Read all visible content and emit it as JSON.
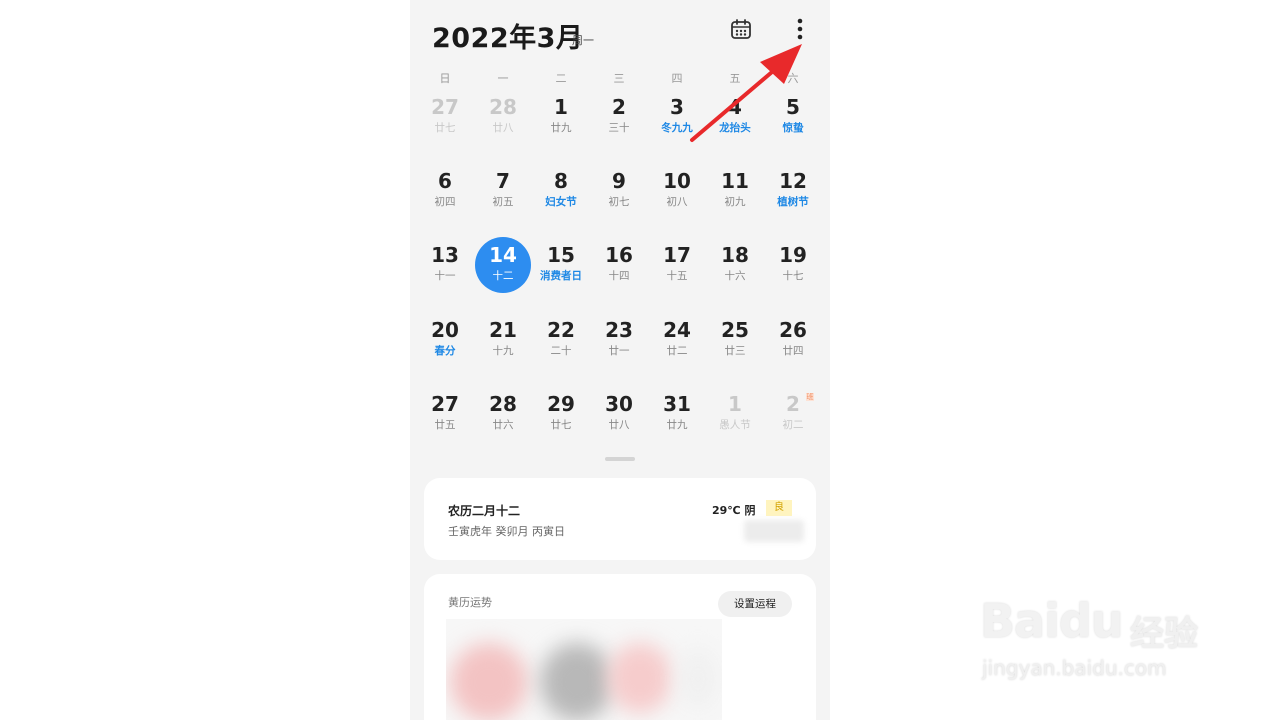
{
  "header": {
    "title": "2022年3月",
    "subtitle": "周一"
  },
  "weekdays": [
    "日",
    "一",
    "二",
    "三",
    "四",
    "五",
    "六"
  ],
  "calendar": {
    "weeks": [
      [
        {
          "day": "27",
          "sub": "廿七",
          "state": "out"
        },
        {
          "day": "28",
          "sub": "廿八",
          "state": "out"
        },
        {
          "day": "1",
          "sub": "廿九"
        },
        {
          "day": "2",
          "sub": "三十"
        },
        {
          "day": "3",
          "sub": "冬九九",
          "festival": true
        },
        {
          "day": "4",
          "sub": "龙抬头",
          "festival": true
        },
        {
          "day": "5",
          "sub": "惊蛰",
          "festival": true
        }
      ],
      [
        {
          "day": "6",
          "sub": "初四"
        },
        {
          "day": "7",
          "sub": "初五"
        },
        {
          "day": "8",
          "sub": "妇女节",
          "festival": true
        },
        {
          "day": "9",
          "sub": "初七"
        },
        {
          "day": "10",
          "sub": "初八"
        },
        {
          "day": "11",
          "sub": "初九"
        },
        {
          "day": "12",
          "sub": "植树节",
          "festival": true
        }
      ],
      [
        {
          "day": "13",
          "sub": "十一"
        },
        {
          "day": "14",
          "sub": "十二",
          "selected": true
        },
        {
          "day": "15",
          "sub": "消费者日",
          "festival": true
        },
        {
          "day": "16",
          "sub": "十四"
        },
        {
          "day": "17",
          "sub": "十五"
        },
        {
          "day": "18",
          "sub": "十六"
        },
        {
          "day": "19",
          "sub": "十七"
        }
      ],
      [
        {
          "day": "20",
          "sub": "春分",
          "festival": true
        },
        {
          "day": "21",
          "sub": "十九"
        },
        {
          "day": "22",
          "sub": "二十"
        },
        {
          "day": "23",
          "sub": "廿一"
        },
        {
          "day": "24",
          "sub": "廿二"
        },
        {
          "day": "25",
          "sub": "廿三"
        },
        {
          "day": "26",
          "sub": "廿四"
        }
      ],
      [
        {
          "day": "27",
          "sub": "廿五"
        },
        {
          "day": "28",
          "sub": "廿六"
        },
        {
          "day": "29",
          "sub": "廿七"
        },
        {
          "day": "30",
          "sub": "廿八"
        },
        {
          "day": "31",
          "sub": "廿九"
        },
        {
          "day": "1",
          "sub": "愚人节",
          "state": "out"
        },
        {
          "day": "2",
          "sub": "初二",
          "state": "out",
          "badge": "班"
        }
      ]
    ]
  },
  "info_card": {
    "lunar_date": "农历二月十二",
    "ganzhi": "壬寅虎年 癸卯月 丙寅日",
    "weather": "29℃ 阴",
    "aqi": "良"
  },
  "almanac_card": {
    "title": "黄历运势",
    "set_button": "设置运程"
  },
  "watermark": {
    "brand": "Baidu",
    "cn": "经验",
    "url": "jingyan.baidu.com"
  },
  "colors": {
    "accent": "#2d8df0",
    "festival": "#1e88e5",
    "annotation_arrow": "#e8292b"
  },
  "icons": {
    "today": "calendar-icon",
    "more": "more-vertical-icon",
    "annotation": "red-arrow-icon"
  }
}
